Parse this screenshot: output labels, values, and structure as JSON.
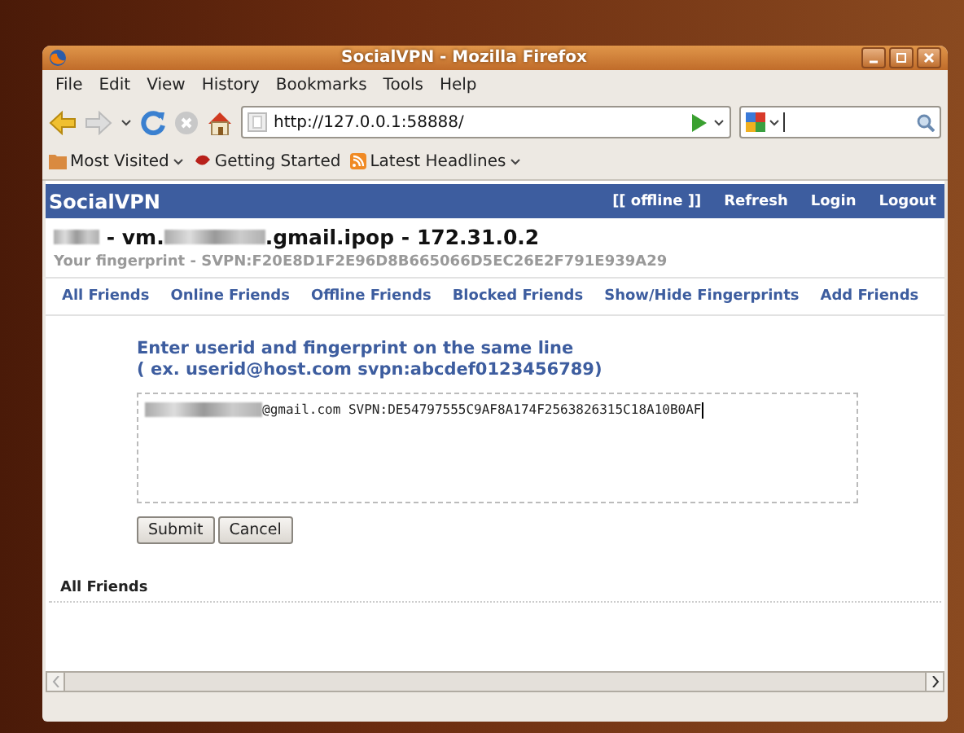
{
  "window": {
    "title": "SocialVPN - Mozilla Firefox"
  },
  "menu": [
    "File",
    "Edit",
    "View",
    "History",
    "Bookmarks",
    "Tools",
    "Help"
  ],
  "toolbar": {
    "url": "http://127.0.0.1:58888/"
  },
  "bookmarks": [
    {
      "label": "Most Visited",
      "kind": "folder",
      "dropdown": true
    },
    {
      "label": "Getting Started",
      "kind": "page",
      "dropdown": false
    },
    {
      "label": "Latest Headlines",
      "kind": "feed",
      "dropdown": true
    }
  ],
  "page": {
    "brand": "SocialVPN",
    "header_links": [
      "[[ offline ]]",
      "Refresh",
      "Login",
      "Logout"
    ],
    "identity": [
      {
        "kind": "redacted"
      },
      {
        "kind": "text",
        "text": " - vm."
      },
      {
        "kind": "redacted"
      },
      {
        "kind": "text",
        "text": ".gmail.ipop - 172.31.0.2"
      }
    ],
    "fingerprint": "Your fingerprint - SVPN:F20E8D1F2E96D8B665066D5EC26E2F791E939A29",
    "nav": [
      "All Friends",
      "Online Friends",
      "Offline Friends",
      "Blocked Friends",
      "Show/Hide Fingerprints",
      "Add Friends"
    ],
    "form": {
      "instructions": [
        "Enter userid and fingerprint on the same line",
        "( ex. userid@host.com svpn:abcdef0123456789)"
      ],
      "value": [
        {
          "kind": "redacted"
        },
        {
          "kind": "text",
          "text": "@gmail.com SVPN:DE54797555C9AF8A174F2563826315C18A10B0AF"
        }
      ],
      "buttons": [
        "Submit",
        "Cancel"
      ]
    },
    "section_title": "All Friends"
  }
}
